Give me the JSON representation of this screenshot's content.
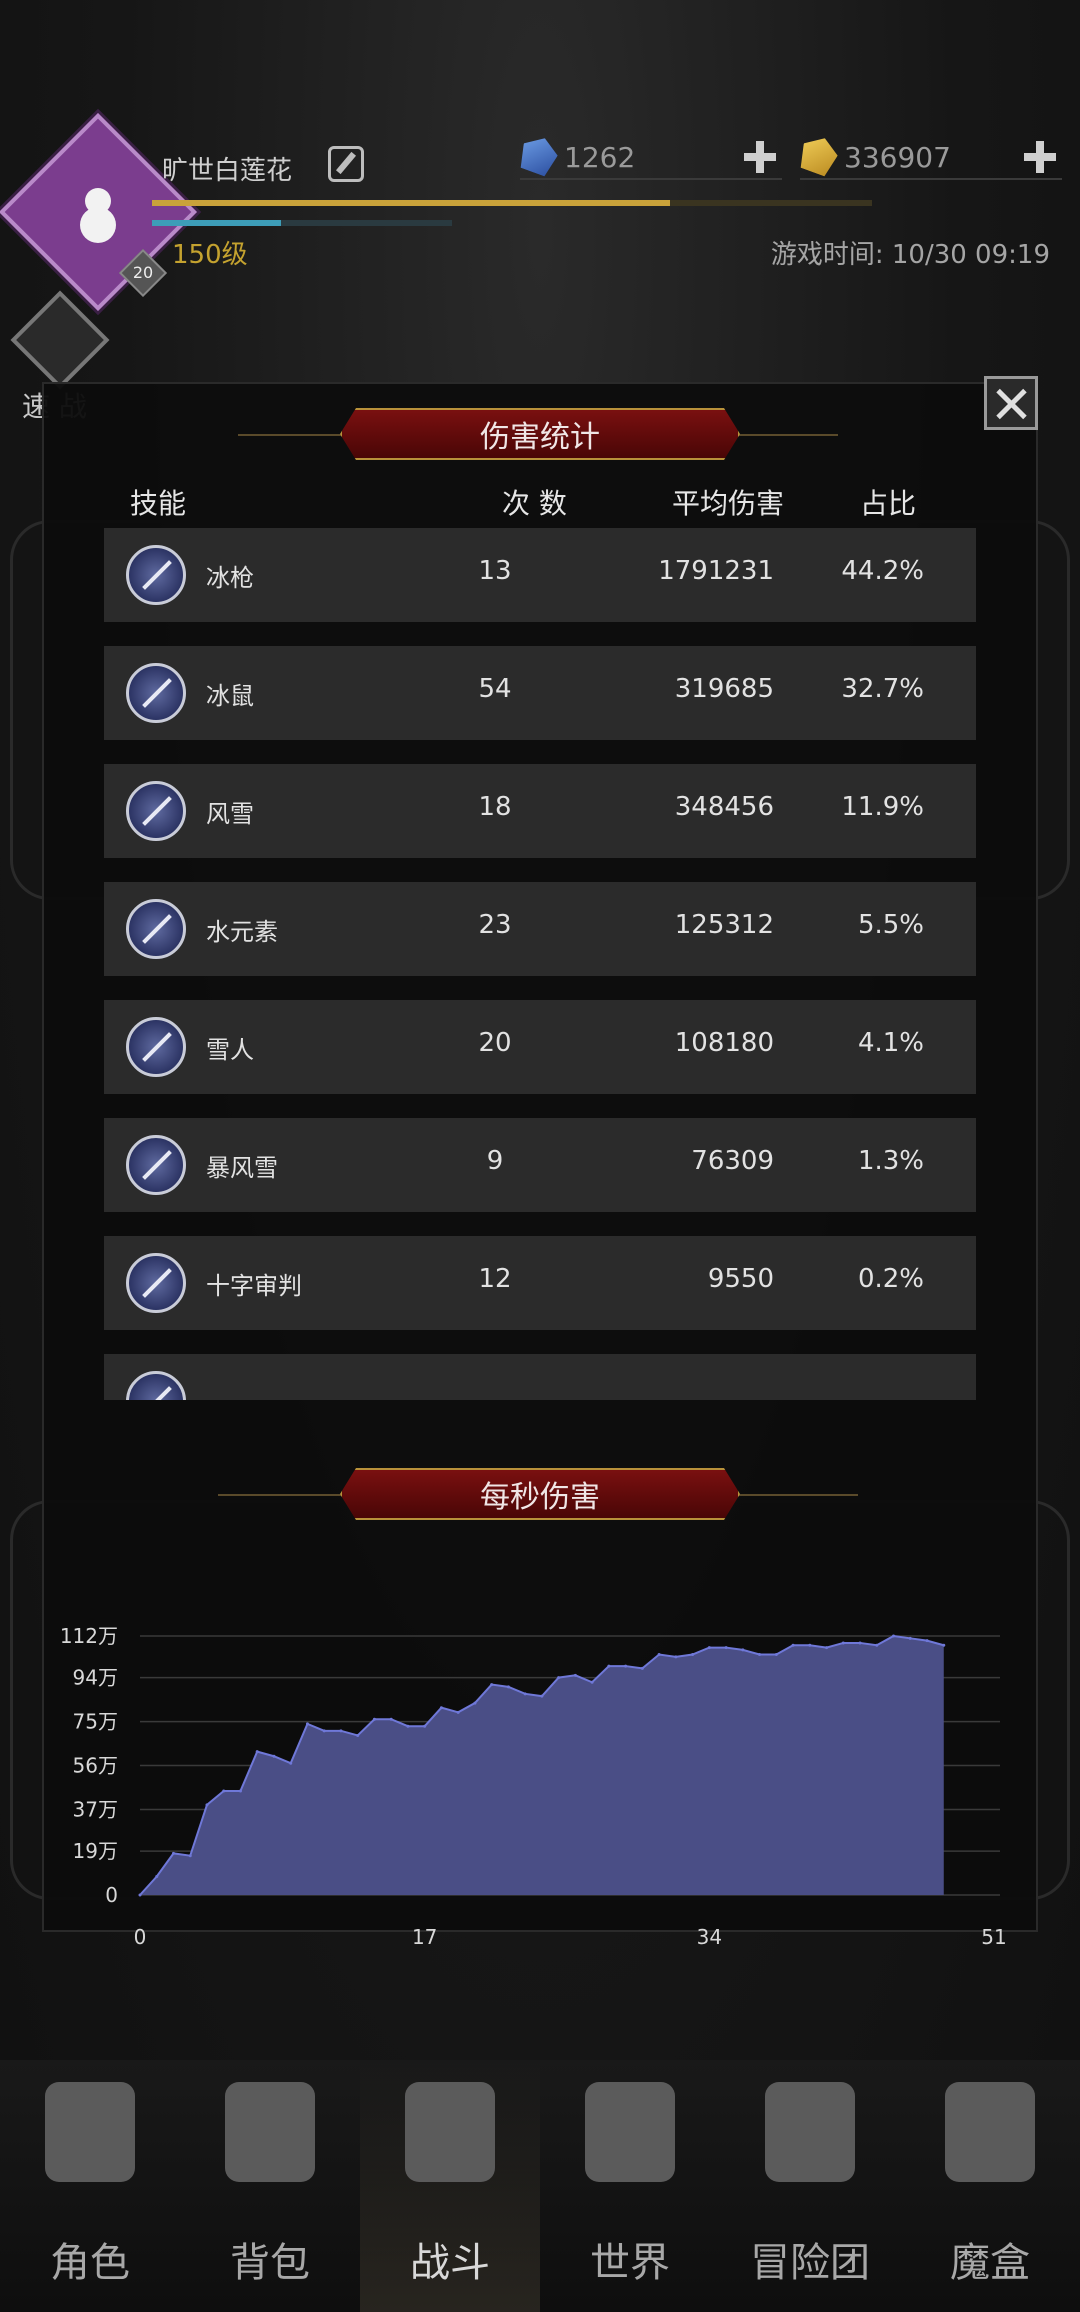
{
  "player": {
    "name": "旷世白莲花",
    "level": "150级",
    "badge": "20",
    "exp_progress": 0.72,
    "hp_progress": 0.43
  },
  "currency": {
    "gems": "1262",
    "gold": "336907"
  },
  "game_time": "游戏时间: 10/30 09:19",
  "quick_battle_label": "速 战",
  "damage_panel": {
    "title": "伤害统计",
    "columns": [
      "技能",
      "次 数",
      "平均伤害",
      "占比"
    ],
    "rows": [
      {
        "name": "冰枪",
        "count": "13",
        "avg": "1791231",
        "pct": "44.2%",
        "icon": "ice-spear-icon"
      },
      {
        "name": "冰鼠",
        "count": "54",
        "avg": "319685",
        "pct": "32.7%",
        "icon": "ice-rat-icon"
      },
      {
        "name": "风雪",
        "count": "18",
        "avg": "348456",
        "pct": "11.9%",
        "icon": "blizzard-blade-icon"
      },
      {
        "name": "水元素",
        "count": "23",
        "avg": "125312",
        "pct": "5.5%",
        "icon": "water-elemental-icon"
      },
      {
        "name": "雪人",
        "count": "20",
        "avg": "108180",
        "pct": "4.1%",
        "icon": "snowflake-icon"
      },
      {
        "name": "暴风雪",
        "count": "9",
        "avg": "76309",
        "pct": "1.3%",
        "icon": "storm-icon"
      },
      {
        "name": "十字审判",
        "count": "12",
        "avg": "9550",
        "pct": "0.2%",
        "icon": "cross-judgment-icon"
      },
      {
        "name": "",
        "count": "",
        "avg": "",
        "pct": "",
        "icon": "partial-skill-icon"
      }
    ]
  },
  "dps_title": "每秒伤害",
  "chart_data": {
    "type": "area",
    "title": "每秒伤害",
    "xlabel": "",
    "ylabel": "",
    "x_ticks": [
      "0",
      "17",
      "34",
      "51"
    ],
    "y_ticks": [
      "0",
      "19万",
      "37万",
      "56万",
      "75万",
      "94万",
      "112万"
    ],
    "xlim": [
      0,
      51
    ],
    "ylim": [
      0,
      112
    ],
    "y_unit": "万",
    "color": "#4a4e86",
    "line_color": "#6f78d8",
    "x": [
      0,
      1,
      2,
      3,
      4,
      5,
      6,
      7,
      8,
      9,
      10,
      11,
      12,
      13,
      14,
      15,
      16,
      17,
      18,
      19,
      20,
      21,
      22,
      23,
      24,
      25,
      26,
      27,
      28,
      29,
      30,
      31,
      32,
      33,
      34,
      35,
      36,
      37,
      38,
      39,
      40,
      41,
      42,
      43,
      44,
      45,
      46,
      47,
      48
    ],
    "y": [
      0,
      8,
      18,
      17,
      39,
      45,
      45,
      62,
      60,
      57,
      74,
      71,
      71,
      69,
      76,
      76,
      73,
      73,
      81,
      79,
      83,
      91,
      90,
      87,
      86,
      94,
      95,
      92,
      99,
      99,
      98,
      104,
      103,
      104,
      107,
      107,
      106,
      104,
      104,
      108,
      108,
      107,
      109,
      109,
      108,
      112,
      111,
      110,
      108
    ]
  },
  "nav": {
    "items": [
      {
        "label": "角色",
        "icon": "helmet-icon",
        "active": false
      },
      {
        "label": "背包",
        "icon": "backpack-icon",
        "active": false
      },
      {
        "label": "战斗",
        "icon": "sword-shield-icon",
        "active": true
      },
      {
        "label": "世界",
        "icon": "map-scroll-icon",
        "active": false
      },
      {
        "label": "冒险团",
        "icon": "castle-icon",
        "active": false
      },
      {
        "label": "魔盒",
        "icon": "magic-cube-icon",
        "active": false
      }
    ]
  }
}
